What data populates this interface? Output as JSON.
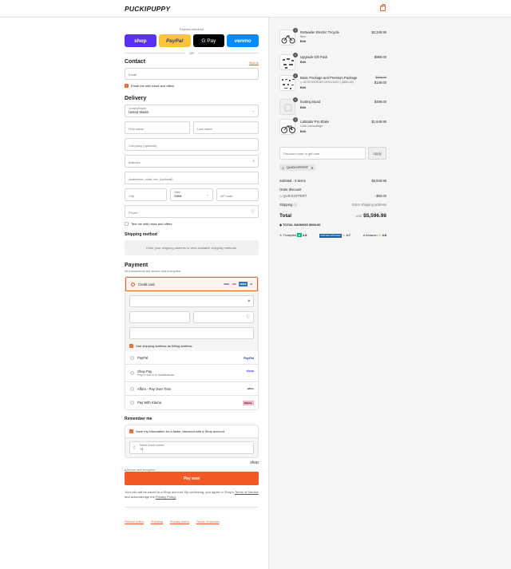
{
  "brand": "PUCKIPUPPY",
  "express": {
    "title": "Express checkout",
    "buttons": [
      "shop",
      "PayPal",
      "G Pay",
      "venmo"
    ],
    "or": "OR"
  },
  "contact": {
    "title": "Contact",
    "signin": "Sign in",
    "email_placeholder": "Email",
    "news": "Email me with news and offers"
  },
  "delivery": {
    "title": "Delivery",
    "country_label": "Country/Region",
    "country": "United States",
    "first": "First name",
    "last": "Last name",
    "company": "Company (optional)",
    "address": "Address",
    "apt": "Apartment, suite, etc. (optional)",
    "city": "City",
    "state_label": "State",
    "state": "Iowa",
    "zip": "ZIP code",
    "phone": "Phone",
    "text_news": "Text me with news and offers"
  },
  "shipping": {
    "title": "Shipping method",
    "note": "Enter your shipping address to view available shipping methods."
  },
  "payment": {
    "title": "Payment",
    "subtitle": "All transactions are secure and encrypted.",
    "credit": "Credit card",
    "card_icons": [
      "VISA",
      "MC",
      "AMEX",
      "+5"
    ],
    "billing": "Use shipping address as billing address",
    "paypal": "PayPal",
    "shoppay": "Shop Pay",
    "shoppay_sub": "Pay in full or in installments",
    "affirm": "Affirm - Pay Over Time",
    "klarna": "Pay With Klarna",
    "icons": {
      "paypal": "PayPal",
      "shop": "shop",
      "affirm": "affirm",
      "klarna": "Klarna."
    }
  },
  "remember": {
    "title": "Remember me",
    "save": "Save my information for a faster checkout with a Shop account",
    "phone_label": "Mobile phone number",
    "phone_val": "+1",
    "secure": "Secure and encrypted",
    "shop": "shop"
  },
  "paynow": "Pay now",
  "legal": {
    "pre": "Your info will be saved to a Shop account. By continuing, you agree to Shop's",
    "tos": "Terms of Service",
    "mid": "and acknowledge the",
    "privacy": "Privacy Policy."
  },
  "footer_links": [
    "Refund policy",
    "Shipping",
    "Privacy policy",
    "Terms of service"
  ],
  "items": [
    {
      "qty": "1",
      "name": "Rottweiler Electric Tricycle",
      "sub": "Blue",
      "edit": "Edit",
      "price": "$2,349.99",
      "old": ""
    },
    {
      "qty": "1",
      "name": "Upgrade Gift Pack",
      "sub": "",
      "edit": "Edit",
      "price": "$999.00",
      "old": ""
    },
    {
      "qty": "1",
      "name": "Basic Package and Premium Package",
      "sub": "ACCESSORIES DISCOUNT (-$850.00)",
      "edit": "Edit",
      "price": "$149.00",
      "old": "$999.00"
    },
    {
      "qty": "1",
      "name": "hunting tripod",
      "sub": "",
      "edit": "Edit",
      "price": "$499.00",
      "old": ""
    },
    {
      "qty": "1",
      "name": "Labrador Pro Ebike",
      "sub": "Lime Camouflage",
      "edit": "Edit",
      "price": "$1,649.99",
      "old": ""
    }
  ],
  "discount": {
    "placeholder": "Discount code or gift card",
    "apply": "Apply",
    "code": "QUICKOFFERT"
  },
  "summary": {
    "subtotal_label": "Subtotal · 5 items",
    "subtotal": "$5,646.98",
    "order_discount": "Order discount",
    "code": "QUICKOFFERT",
    "code_amt": "- $50.00",
    "shipping_label": "Shipping",
    "shipping": "Enter shipping address",
    "total_label": "Total",
    "currency": "USD",
    "total": "$5,596.98",
    "savings_label": "TOTAL SAVINGS",
    "savings": "$900.00"
  },
  "reviews": {
    "trustpilot": "Trustpilot",
    "tp_score": "4.8",
    "badge": "SHOPPER APPROVED",
    "sa_score": "4.7",
    "amazon": "Amazon",
    "am_score": "4.8"
  },
  "colors": {
    "accent": "#e8622a",
    "paynow": "#f15a24",
    "shop": "#5a31f4",
    "paypal": "#ffc439",
    "venmo": "#008cff"
  }
}
